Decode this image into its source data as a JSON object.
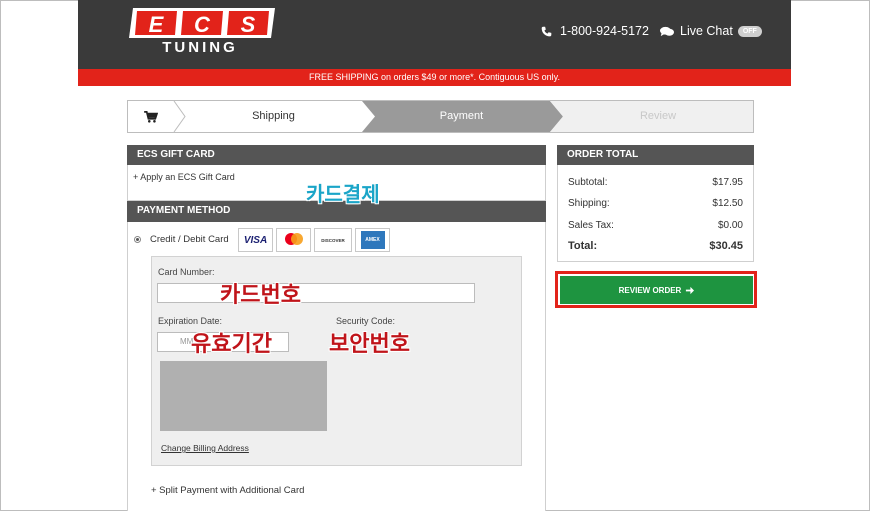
{
  "header": {
    "logo_line1": "ECS",
    "logo_line2": "TUNING",
    "phone": "1-800-924-5172",
    "live_chat": "Live Chat",
    "chat_toggle": "OFF",
    "banner": "FREE SHIPPING on orders $49 or more*. Contiguous US only."
  },
  "steps": [
    {
      "label": "Shipping",
      "state": "completed"
    },
    {
      "label": "Payment",
      "state": "active"
    },
    {
      "label": "Review",
      "state": "upcoming"
    }
  ],
  "gift_card": {
    "title": "ECS GIFT CARD",
    "apply_link": "+ Apply an ECS Gift Card"
  },
  "payment": {
    "title": "PAYMENT METHOD",
    "method_label": "Credit / Debit Card",
    "card_brands": [
      "VISA",
      "MasterCard",
      "DISCOVER",
      "AMEX"
    ],
    "card_number_label": "Card Number:",
    "card_number_value": "",
    "expiration_label": "Expiration Date:",
    "expiration_placeholder": "MM",
    "security_label": "Security Code:",
    "change_billing": "Change Billing Address",
    "split_payment": "+ Split Payment with Additional Card"
  },
  "annotations": {
    "card_payment": "카드결제",
    "card_number": "카드번호",
    "expiry": "유효기간",
    "security": "보안번호"
  },
  "order_total": {
    "title": "ORDER TOTAL",
    "rows": [
      {
        "label": "Subtotal:",
        "value": "$17.95"
      },
      {
        "label": "Shipping:",
        "value": "$12.50"
      },
      {
        "label": "Sales Tax:",
        "value": "$0.00"
      }
    ],
    "total_label": "Total:",
    "total_value": "$30.45",
    "review_button": "REVIEW ORDER"
  },
  "colors": {
    "header_bg": "#3a3a3a",
    "brand_red": "#e2231a",
    "panel_head": "#555555",
    "review_green": "#1e9440",
    "annotation_blue": "#1aa5c8",
    "annotation_red": "#c0141a"
  }
}
